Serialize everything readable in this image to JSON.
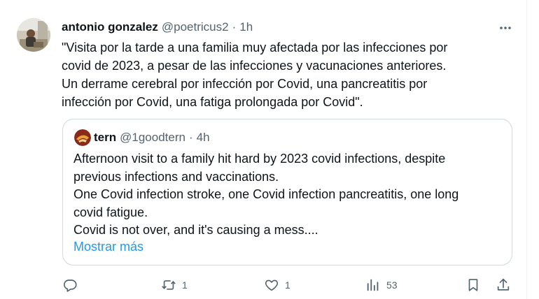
{
  "tweet": {
    "author_name": "antonio gonzalez",
    "author_handle": "@poetricus2",
    "separator": "·",
    "time": "1h",
    "text_lines": [
      "\"Visita por la tarde a una familia muy afectada por las infecciones por",
      "covid de 2023, a pesar de las infecciones y vacunaciones anteriores.",
      "Un derrame cerebral por infección por Covid, una pancreatitis por",
      "infección por Covid, una fatiga prolongada por Covid\"."
    ]
  },
  "quote": {
    "author_name": "tern",
    "author_handle": "@1goodtern",
    "separator": "·",
    "time": "4h",
    "text_lines": [
      "Afternoon visit to a family hit hard by 2023 covid infections, despite",
      "previous infections and vaccinations.",
      "One Covid infection stroke, one Covid infection pancreatitis, one long",
      "covid fatigue.",
      "Covid is not over, and it's causing a mess...."
    ],
    "show_more": "Mostrar más"
  },
  "actions": {
    "reply": {
      "icon": "reply-icon",
      "count": ""
    },
    "retweet": {
      "icon": "retweet-icon",
      "count": "1"
    },
    "like": {
      "icon": "heart-icon",
      "count": "1"
    },
    "views": {
      "icon": "views-icon",
      "count": "53"
    },
    "bookmark": {
      "icon": "bookmark-icon"
    },
    "share": {
      "icon": "share-icon"
    }
  },
  "colors": {
    "text": "#0f1419",
    "secondary": "#536471",
    "link": "#1d9bf0",
    "border": "#cfd9de"
  }
}
